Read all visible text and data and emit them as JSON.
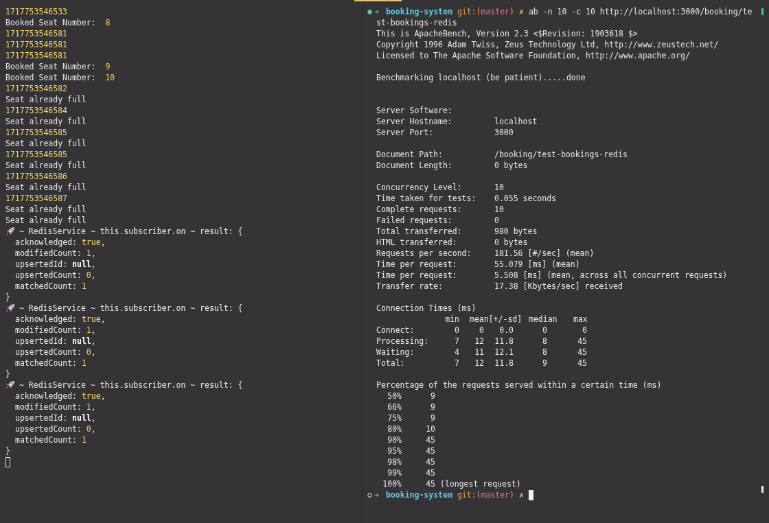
{
  "left_pane": {
    "lines": [
      {
        "kind": "log",
        "segments": [
          {
            "kind": "number",
            "text": "1717753546533"
          }
        ]
      },
      {
        "kind": "log",
        "segments": [
          {
            "kind": "plain",
            "text": "Booked Seat Number:  "
          },
          {
            "kind": "number",
            "text": "8"
          }
        ]
      },
      {
        "kind": "log",
        "segments": [
          {
            "kind": "number",
            "text": "1717753546581"
          }
        ]
      },
      {
        "kind": "log",
        "segments": [
          {
            "kind": "number",
            "text": "1717753546581"
          }
        ]
      },
      {
        "kind": "log",
        "segments": [
          {
            "kind": "number",
            "text": "1717753546581"
          }
        ]
      },
      {
        "kind": "log",
        "segments": [
          {
            "kind": "plain",
            "text": "Booked Seat Number:  "
          },
          {
            "kind": "number",
            "text": "9"
          }
        ]
      },
      {
        "kind": "log",
        "segments": [
          {
            "kind": "plain",
            "text": "Booked Seat Number:  "
          },
          {
            "kind": "number",
            "text": "10"
          }
        ]
      },
      {
        "kind": "log",
        "segments": [
          {
            "kind": "number",
            "text": "1717753546582"
          }
        ]
      },
      {
        "kind": "log",
        "segments": [
          {
            "kind": "plain",
            "text": "Seat already full"
          }
        ]
      },
      {
        "kind": "log",
        "segments": [
          {
            "kind": "number",
            "text": "1717753546584"
          }
        ]
      },
      {
        "kind": "log",
        "segments": [
          {
            "kind": "plain",
            "text": "Seat already full"
          }
        ]
      },
      {
        "kind": "log",
        "segments": [
          {
            "kind": "number",
            "text": "1717753546585"
          }
        ]
      },
      {
        "kind": "log",
        "segments": [
          {
            "kind": "plain",
            "text": "Seat already full"
          }
        ]
      },
      {
        "kind": "log",
        "segments": [
          {
            "kind": "number",
            "text": "1717753546585"
          }
        ]
      },
      {
        "kind": "log",
        "segments": [
          {
            "kind": "plain",
            "text": "Seat already full"
          }
        ]
      },
      {
        "kind": "log",
        "segments": [
          {
            "kind": "number",
            "text": "1717753546586"
          }
        ]
      },
      {
        "kind": "log",
        "segments": [
          {
            "kind": "plain",
            "text": "Seat already full"
          }
        ]
      },
      {
        "kind": "log",
        "segments": [
          {
            "kind": "number",
            "text": "1717753546587"
          }
        ]
      },
      {
        "kind": "log",
        "segments": [
          {
            "kind": "plain",
            "text": "Seat already full"
          }
        ]
      },
      {
        "kind": "log",
        "segments": [
          {
            "kind": "plain",
            "text": "Seat already full"
          }
        ]
      },
      {
        "kind": "log-header",
        "segments": [
          {
            "kind": "plain",
            "text": "~ RedisService ~ this.subscriber.on ~ result: {"
          }
        ]
      },
      {
        "kind": "property",
        "segments": [
          {
            "kind": "plain",
            "text": "acknowledged: "
          },
          {
            "kind": "boolean",
            "text": "true"
          },
          {
            "kind": "plain",
            "text": ","
          }
        ]
      },
      {
        "kind": "property",
        "segments": [
          {
            "kind": "plain",
            "text": "modifiedCount: "
          },
          {
            "kind": "number",
            "text": "1"
          },
          {
            "kind": "plain",
            "text": ","
          }
        ]
      },
      {
        "kind": "property",
        "segments": [
          {
            "kind": "plain",
            "text": "upsertedId: "
          },
          {
            "kind": "null",
            "text": "null"
          },
          {
            "kind": "plain",
            "text": ","
          }
        ]
      },
      {
        "kind": "property",
        "segments": [
          {
            "kind": "plain",
            "text": "upsertedCount: "
          },
          {
            "kind": "number",
            "text": "0"
          },
          {
            "kind": "plain",
            "text": ","
          }
        ]
      },
      {
        "kind": "property",
        "segments": [
          {
            "kind": "plain",
            "text": "matchedCount: "
          },
          {
            "kind": "number",
            "text": "1"
          }
        ]
      },
      {
        "kind": "log",
        "segments": [
          {
            "kind": "plain",
            "text": "}"
          }
        ]
      },
      {
        "kind": "log-header",
        "segments": [
          {
            "kind": "plain",
            "text": "~ RedisService ~ this.subscriber.on ~ result: {"
          }
        ]
      },
      {
        "kind": "property",
        "segments": [
          {
            "kind": "plain",
            "text": "acknowledged: "
          },
          {
            "kind": "boolean",
            "text": "true"
          },
          {
            "kind": "plain",
            "text": ","
          }
        ]
      },
      {
        "kind": "property",
        "segments": [
          {
            "kind": "plain",
            "text": "modifiedCount: "
          },
          {
            "kind": "number",
            "text": "1"
          },
          {
            "kind": "plain",
            "text": ","
          }
        ]
      },
      {
        "kind": "property",
        "segments": [
          {
            "kind": "plain",
            "text": "upsertedId: "
          },
          {
            "kind": "null",
            "text": "null"
          },
          {
            "kind": "plain",
            "text": ","
          }
        ]
      },
      {
        "kind": "property",
        "segments": [
          {
            "kind": "plain",
            "text": "upsertedCount: "
          },
          {
            "kind": "number",
            "text": "0"
          },
          {
            "kind": "plain",
            "text": ","
          }
        ]
      },
      {
        "kind": "property",
        "segments": [
          {
            "kind": "plain",
            "text": "matchedCount: "
          },
          {
            "kind": "number",
            "text": "1"
          }
        ]
      },
      {
        "kind": "log",
        "segments": [
          {
            "kind": "plain",
            "text": "}"
          }
        ]
      },
      {
        "kind": "log-header",
        "segments": [
          {
            "kind": "plain",
            "text": "~ RedisService ~ this.subscriber.on ~ result: {"
          }
        ]
      },
      {
        "kind": "property",
        "segments": [
          {
            "kind": "plain",
            "text": "acknowledged: "
          },
          {
            "kind": "boolean",
            "text": "true"
          },
          {
            "kind": "plain",
            "text": ","
          }
        ]
      },
      {
        "kind": "property",
        "segments": [
          {
            "kind": "plain",
            "text": "modifiedCount: "
          },
          {
            "kind": "number",
            "text": "1"
          },
          {
            "kind": "plain",
            "text": ","
          }
        ]
      },
      {
        "kind": "property",
        "segments": [
          {
            "kind": "plain",
            "text": "upsertedId: "
          },
          {
            "kind": "null",
            "text": "null"
          },
          {
            "kind": "plain",
            "text": ","
          }
        ]
      },
      {
        "kind": "property",
        "segments": [
          {
            "kind": "plain",
            "text": "upsertedCount: "
          },
          {
            "kind": "number",
            "text": "0"
          },
          {
            "kind": "plain",
            "text": ","
          }
        ]
      },
      {
        "kind": "property",
        "segments": [
          {
            "kind": "plain",
            "text": "matchedCount: "
          },
          {
            "kind": "number",
            "text": "1"
          }
        ]
      },
      {
        "kind": "log",
        "segments": [
          {
            "kind": "plain",
            "text": "}"
          }
        ]
      }
    ],
    "cursor": {
      "focused": false
    }
  },
  "right_pane": {
    "lines": [
      {
        "kind": "prompt",
        "success": true,
        "arrow": "➜",
        "directory": "booking-system",
        "git_prefix": "git:(",
        "branch": "master",
        "git_suffix": ")",
        "dirty_mark": "✗",
        "command": "ab -n 10 -c 10 http://localhost:3000/booking/te"
      },
      {
        "kind": "text",
        "text": "st-bookings-redis"
      },
      {
        "kind": "text",
        "text": "This is ApacheBench, Version 2.3 <$Revision: 1903618 $>"
      },
      {
        "kind": "text",
        "text": "Copyright 1996 Adam Twiss, Zeus Technology Ltd, http://www.zeustech.net/"
      },
      {
        "kind": "text",
        "text": "Licensed to The Apache Software Foundation, http://www.apache.org/"
      },
      {
        "kind": "blank"
      },
      {
        "kind": "text",
        "text": "Benchmarking localhost (be patient).....done"
      },
      {
        "kind": "blank"
      },
      {
        "kind": "blank"
      },
      {
        "kind": "field",
        "label": "Server Software:"
      },
      {
        "kind": "field",
        "label": "Server Hostname:",
        "value": "localhost"
      },
      {
        "kind": "field",
        "label": "Server Port:",
        "value": "3000"
      },
      {
        "kind": "blank"
      },
      {
        "kind": "field",
        "label": "Document Path:",
        "value": "/booking/test-bookings-redis"
      },
      {
        "kind": "field",
        "label": "Document Length:",
        "value": "0 bytes"
      },
      {
        "kind": "blank"
      },
      {
        "kind": "field",
        "label": "Concurrency Level:",
        "value": "10"
      },
      {
        "kind": "field",
        "label": "Time taken for tests:",
        "value": "0.055 seconds"
      },
      {
        "kind": "field",
        "label": "Complete requests:",
        "value": "10"
      },
      {
        "kind": "field",
        "label": "Failed requests:",
        "value": "0"
      },
      {
        "kind": "field",
        "label": "Total transferred:",
        "value": "980 bytes"
      },
      {
        "kind": "field",
        "label": "HTML transferred:",
        "value": "0 bytes"
      },
      {
        "kind": "field",
        "label": "Requests per second:",
        "value": "181.56 [#/sec] (mean)"
      },
      {
        "kind": "field",
        "label": "Time per request:",
        "value": "55.079 [ms] (mean)"
      },
      {
        "kind": "field",
        "label": "Time per request:",
        "value": "5.508 [ms] (mean, across all concurrent requests)"
      },
      {
        "kind": "field",
        "label": "Transfer rate:",
        "value": "17.38 [Kbytes/sec] received"
      },
      {
        "kind": "blank"
      },
      {
        "kind": "text",
        "text": "Connection Times (ms)"
      },
      {
        "kind": "table-header",
        "columns": [
          "min",
          "mean[+/-sd]",
          "median",
          "max"
        ]
      },
      {
        "kind": "table-row",
        "label": "Connect:",
        "cells": [
          "0",
          "0",
          "0.0",
          "0",
          "0"
        ]
      },
      {
        "kind": "table-row",
        "label": "Processing:",
        "cells": [
          "7",
          "12",
          "11.8",
          "8",
          "45"
        ]
      },
      {
        "kind": "table-row",
        "label": "Waiting:",
        "cells": [
          "4",
          "11",
          "12.1",
          "8",
          "45"
        ]
      },
      {
        "kind": "table-row",
        "label": "Total:",
        "cells": [
          "7",
          "12",
          "11.8",
          "9",
          "45"
        ]
      },
      {
        "kind": "blank"
      },
      {
        "kind": "text",
        "text": "Percentage of the requests served within a certain time (ms)"
      },
      {
        "kind": "percentile",
        "percent": "50%",
        "time": "9"
      },
      {
        "kind": "percentile",
        "percent": "66%",
        "time": "9"
      },
      {
        "kind": "percentile",
        "percent": "75%",
        "time": "9"
      },
      {
        "kind": "percentile",
        "percent": "80%",
        "time": "10"
      },
      {
        "kind": "percentile",
        "percent": "90%",
        "time": "45"
      },
      {
        "kind": "percentile",
        "percent": "95%",
        "time": "45"
      },
      {
        "kind": "percentile",
        "percent": "98%",
        "time": "45"
      },
      {
        "kind": "percentile",
        "percent": "99%",
        "time": "45"
      },
      {
        "kind": "percentile",
        "percent": "100%",
        "time": "45",
        "note": "(longest request)"
      },
      {
        "kind": "prompt",
        "success": false,
        "arrow": "➜",
        "directory": "booking-system",
        "git_prefix": "git:(",
        "branch": "master",
        "git_suffix": ")",
        "dirty_mark": "✗"
      }
    ],
    "cursor": {
      "focused": true
    }
  }
}
